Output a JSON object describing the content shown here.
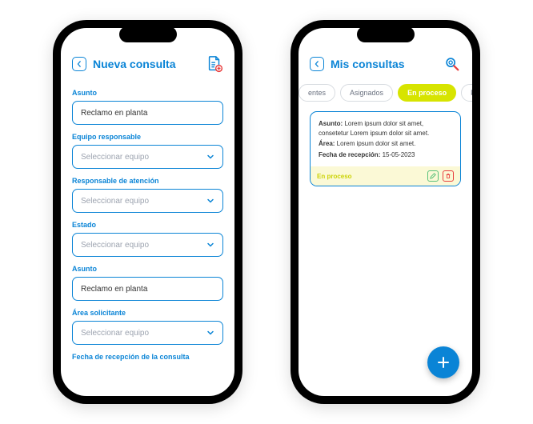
{
  "phone1": {
    "title": "Nueva consulta",
    "fields": [
      {
        "label": "Asunto",
        "value": "Reclamo en planta",
        "type": "input"
      },
      {
        "label": "Equipo responsable",
        "value": "Seleccionar equipo",
        "type": "select"
      },
      {
        "label": "Responsable de atención",
        "value": "Seleccionar equipo",
        "type": "select"
      },
      {
        "label": "Estado",
        "value": "Seleccionar equipo",
        "type": "select"
      },
      {
        "label": "Asunto",
        "value": "Reclamo en planta",
        "type": "input"
      },
      {
        "label": "Área solicitante",
        "value": "Seleccionar equipo",
        "type": "select"
      },
      {
        "label": "Fecha de recepción de la consulta",
        "value": "",
        "type": "none"
      }
    ]
  },
  "phone2": {
    "title": "Mis consultas",
    "tabs": [
      "entes",
      "Asignados",
      "En proceso",
      "Finaliz"
    ],
    "active_tab": 2,
    "card": {
      "asunto_label": "Asunto:",
      "asunto_text": " Lorem ipsum dolor sit amet, consetetur Lorem ipsum dolor sit amet.",
      "area_label": "Área:",
      "area_text": " Lorem ipsum dolor sit amet.",
      "fecha_label": "Fecha de recepción:",
      "fecha_text": " 15-05-2023",
      "status": "En proceso"
    }
  }
}
